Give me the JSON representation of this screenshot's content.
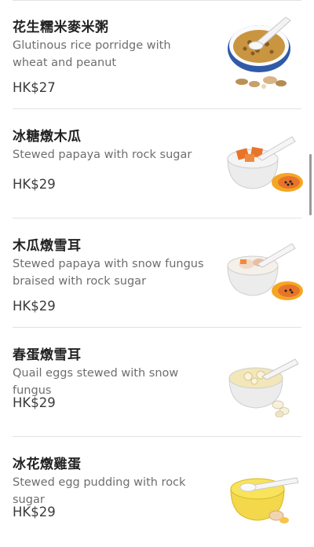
{
  "menu": {
    "items": [
      {
        "name": "花生糯米麥米粥",
        "description": "Glutinous rice porridge with wheat and peanut",
        "price": "HK$27",
        "image_icon": "peanut-porridge-icon"
      },
      {
        "name": "冰糖燉木瓜",
        "description": "Stewed papaya with rock sugar",
        "price": "HK$29",
        "image_icon": "papaya-dessert-icon"
      },
      {
        "name": "木瓜燉雪耳",
        "description": "Stewed papaya with snow fungus braised with rock sugar",
        "price": "HK$29",
        "image_icon": "papaya-snow-fungus-icon"
      },
      {
        "name": "春蛋燉雪耳",
        "description": "Quail eggs stewed with snow fungus",
        "price": "HK$29",
        "image_icon": "quail-egg-soup-icon"
      },
      {
        "name": "冰花燉雞蛋",
        "description": "Stewed egg pudding with rock sugar",
        "price": "HK$29",
        "image_icon": "egg-pudding-icon"
      }
    ]
  },
  "colors": {
    "divider": "#e2e2e2",
    "text_primary": "#222222",
    "text_secondary": "#6e6e6e",
    "papaya": "#e8742a"
  }
}
